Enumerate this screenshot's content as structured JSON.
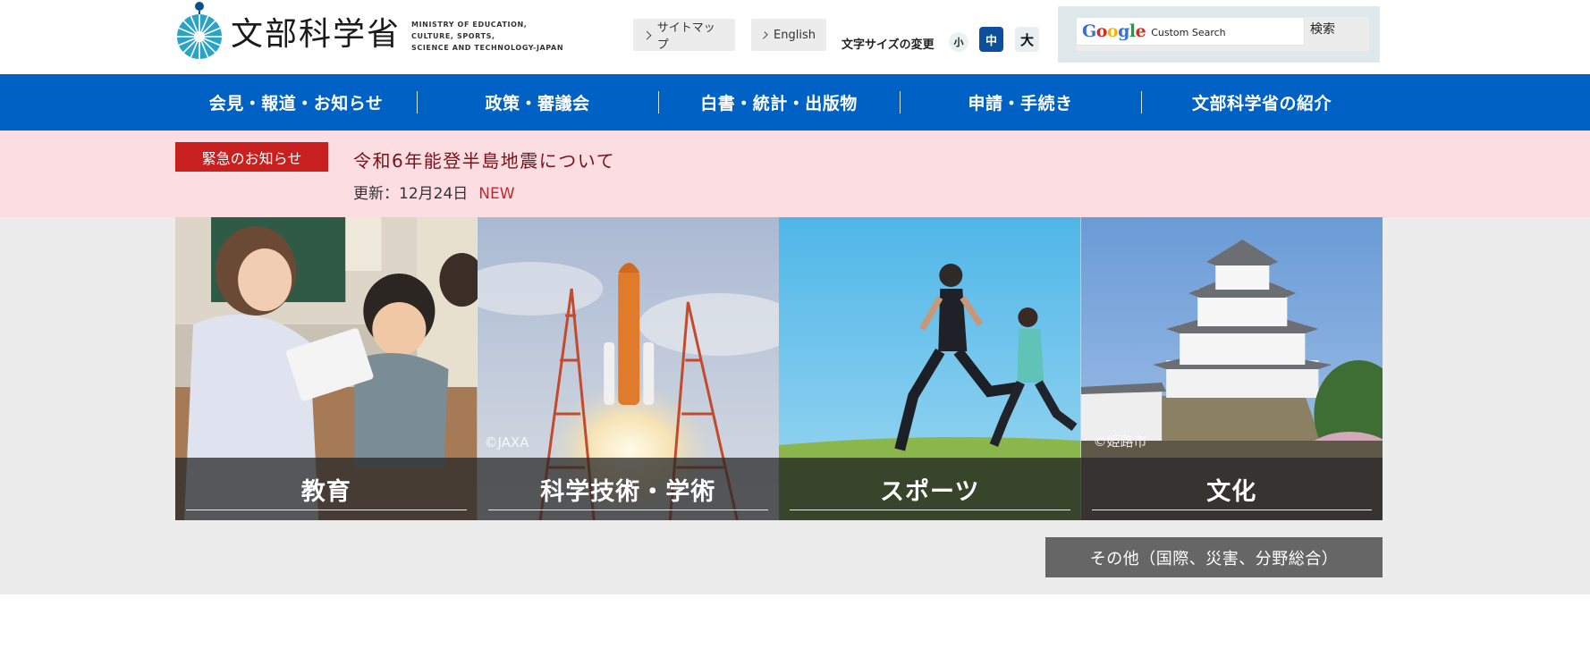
{
  "header": {
    "logo_text_ja": "文部科学省",
    "logo_text_en": [
      "MINISTRY OF EDUCATION,",
      "CULTURE, SPORTS,",
      "SCIENCE AND TECHNOLOGY-JAPAN"
    ],
    "sitemap_label": "サイトマップ",
    "english_label": "English",
    "font_size_label": "文字サイズの変更",
    "font_size_options": {
      "small": "小",
      "medium": "中",
      "large": "大"
    },
    "font_size_selected": "中"
  },
  "search": {
    "brand": "Google",
    "placeholder": "Custom Search",
    "button_label": "検索"
  },
  "nav": {
    "items": [
      {
        "label": "会見・報道・お知らせ"
      },
      {
        "label": "政策・審議会"
      },
      {
        "label": "白書・統計・出版物"
      },
      {
        "label": "申請・手続き"
      },
      {
        "label": "文部科学省の紹介"
      }
    ]
  },
  "emergency": {
    "badge": "緊急のお知らせ",
    "title": "令和6年能登半島地震について",
    "update": "更新：12月24日",
    "new_label": "NEW"
  },
  "tiles": [
    {
      "label": "教育",
      "credit": ""
    },
    {
      "label": "科学技術・学術",
      "credit": "©JAXA"
    },
    {
      "label": "スポーツ",
      "credit": ""
    },
    {
      "label": "文化",
      "credit": "©姫路市"
    }
  ],
  "other_button": "その他（国際、災害、分野総合）",
  "colors": {
    "nav_blue": "#0061c4",
    "emergency_bg": "#fbdde2",
    "emergency_badge": "#c81f1f",
    "font_size_active": "#0d4f9c"
  },
  "icons": {
    "logo": "mext-logo-icon",
    "link_chevron": "chevron-right-icon"
  }
}
